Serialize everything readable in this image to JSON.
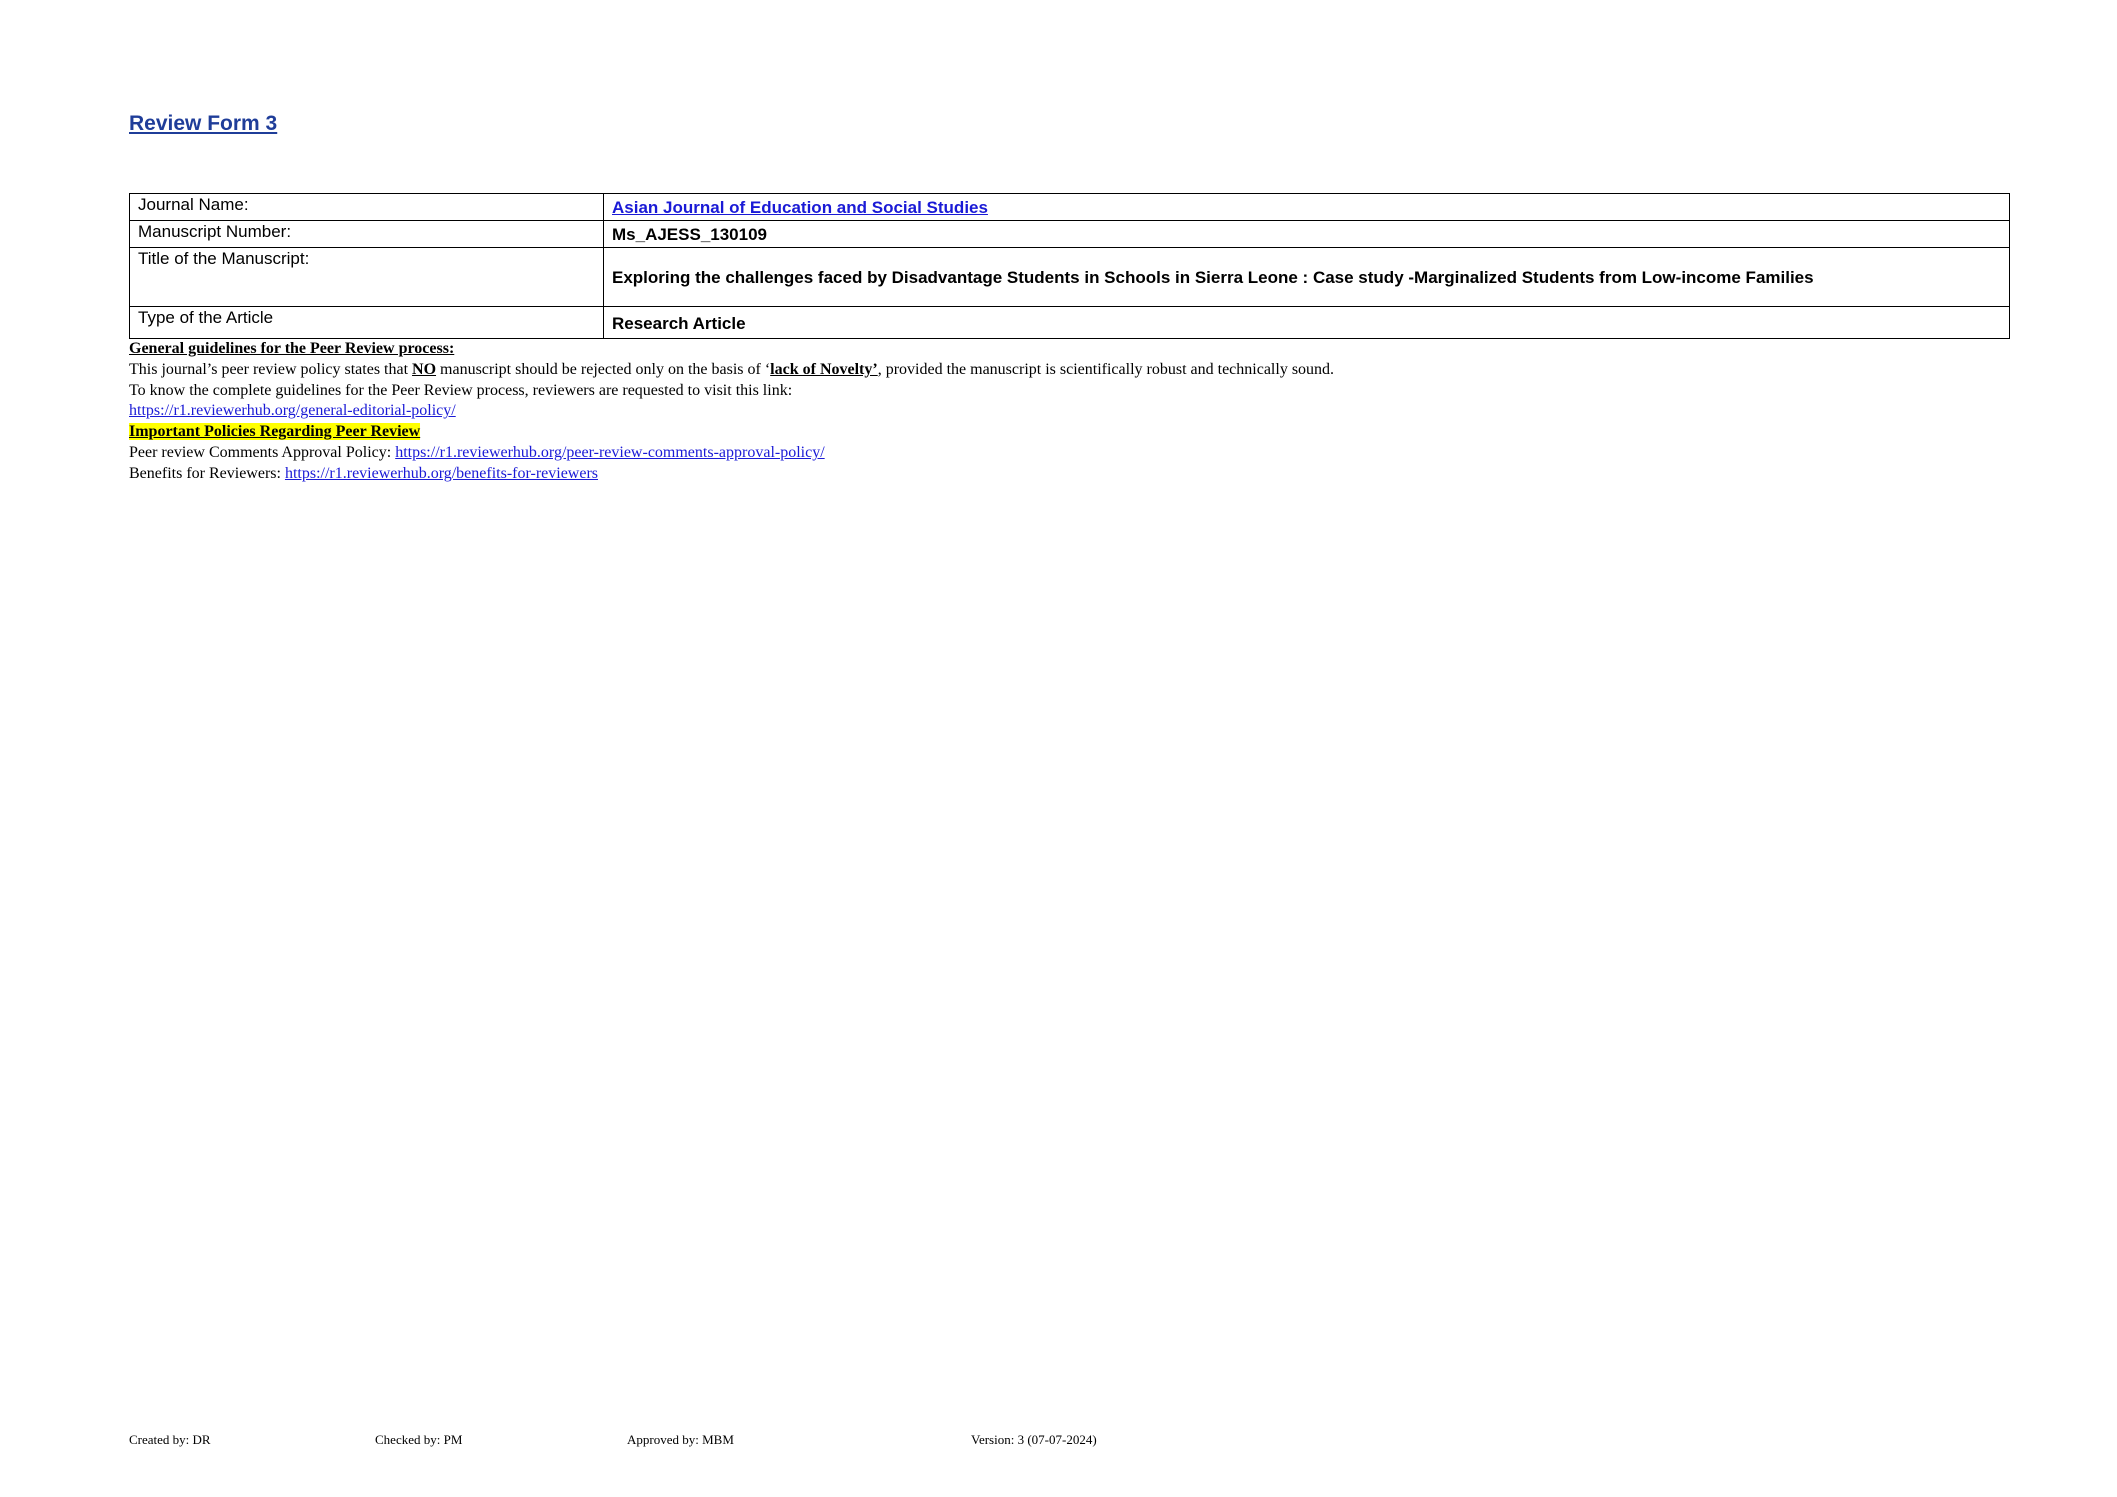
{
  "header": {
    "title": "Review Form 3"
  },
  "info_table": {
    "journal_label": "Journal Name:",
    "journal_value": "Asian Journal of Education and Social Studies",
    "manuscript_number_label": "Manuscript Number:",
    "manuscript_number_value": "Ms_AJESS_130109",
    "title_label": "Title of the Manuscript:",
    "title_value": "Exploring the challenges faced by Disadvantage Students in Schools in Sierra Leone : Case study -Marginalized Students from Low-income Families",
    "article_type_label": "Type of the Article",
    "article_type_value": "Research Article"
  },
  "guidelines": {
    "heading": "General guidelines for the Peer Review process:",
    "policy_prefix": "This journal’s peer review policy states that ",
    "policy_no": "NO",
    "policy_mid": " manuscript should be rejected only on the basis of ‘",
    "policy_novelty": "lack of Novelty’",
    "policy_suffix": ", provided the manuscript is scientifically robust and technically sound.",
    "complete_text": "To know the complete guidelines for the Peer Review process, reviewers are requested to visit this link:",
    "editorial_policy_link": "https://r1.reviewerhub.org/general-editorial-policy/",
    "important_heading": "Important Policies Regarding Peer Review",
    "approval_label": "Peer review Comments Approval Policy: ",
    "approval_link": "https://r1.reviewerhub.org/peer-review-comments-approval-policy/",
    "benefits_label": "Benefits for Reviewers: ",
    "benefits_link": "https://r1.reviewerhub.org/benefits-for-reviewers"
  },
  "footer": {
    "created_by": "Created by: DR",
    "checked_by": "Checked by: PM",
    "approved_by": "Approved by: MBM",
    "version": "Version: 3 (07-07-2024)"
  }
}
